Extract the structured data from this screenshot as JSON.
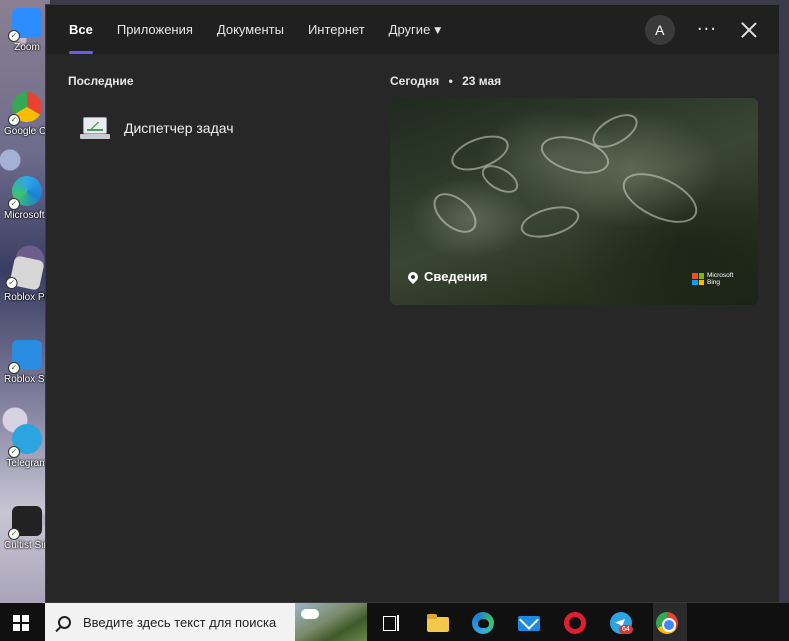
{
  "desktop": {
    "icons": [
      {
        "label": "Zoom",
        "color": "#2d8cff"
      },
      {
        "label": "Google Chrome",
        "color": "#fbbc05"
      },
      {
        "label": "Microsoft Edge",
        "color": "#1b7fd6"
      },
      {
        "label": "Roblox Player",
        "color": "#d7d7d7"
      },
      {
        "label": "Roblox Studio",
        "color": "#2a8ce0"
      },
      {
        "label": "Telegram",
        "color": "#2ca4e0"
      },
      {
        "label": "Cultist Simulator",
        "color": "#222222"
      }
    ]
  },
  "search_panel": {
    "tabs": [
      {
        "label": "Все",
        "active": true
      },
      {
        "label": "Приложения",
        "active": false
      },
      {
        "label": "Документы",
        "active": false
      },
      {
        "label": "Интернет",
        "active": false
      },
      {
        "label": "Другие",
        "active": false,
        "dropdown": true
      }
    ],
    "dropdown_caret": "▼",
    "avatar_letter": "A",
    "more_label": "···",
    "recent": {
      "title": "Последние",
      "items": [
        {
          "label": "Диспетчер задач",
          "icon": "task-manager-icon"
        }
      ]
    },
    "today": {
      "title": "Сегодня",
      "separator": "•",
      "date": "23 мая",
      "card": {
        "info_label": "Сведения",
        "brand_line1": "Microsoft",
        "brand_line2": "Bing"
      }
    },
    "accent_color": "#6a5af0"
  },
  "taskbar": {
    "search_placeholder": "Введите здесь текст для поиска",
    "apps": [
      "task-view-icon",
      "file-explorer-icon",
      "edge-icon",
      "mail-icon",
      "opera-icon",
      "telegram-icon",
      "chrome-icon"
    ],
    "telegram_badge": "64"
  }
}
